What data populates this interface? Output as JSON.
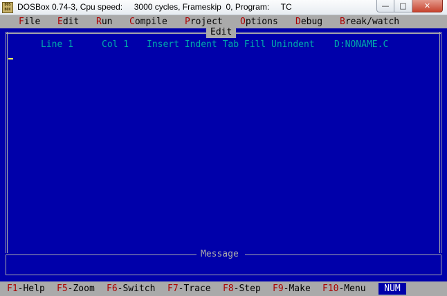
{
  "window": {
    "title": "DOSBox 0.74-3, Cpu speed:     3000 cycles, Frameskip  0, Program:     TC",
    "icon_label": "DOS BOX",
    "minimize_glyph": "—",
    "maximize_glyph": "□",
    "close_glyph": "✕"
  },
  "menu": {
    "items": [
      {
        "hot": "F",
        "rest": "ile"
      },
      {
        "hot": "E",
        "rest": "dit"
      },
      {
        "hot": "R",
        "rest": "un"
      },
      {
        "hot": "C",
        "rest": "ompile"
      },
      {
        "hot": "P",
        "rest": "roject"
      },
      {
        "hot": "O",
        "rest": "ptions"
      },
      {
        "hot": "D",
        "rest": "ebug"
      },
      {
        "hot": "B",
        "rest": "reak/watch"
      }
    ]
  },
  "editor": {
    "title": "Edit",
    "status": {
      "line": "Line 1",
      "col": "Col 1",
      "modes": "Insert Indent Tab Fill Unindent",
      "file": "D:NONAME.C"
    }
  },
  "message": {
    "title": "Message"
  },
  "fkeys": {
    "items": [
      {
        "key": "F1",
        "label": "-Help"
      },
      {
        "key": "F5",
        "label": "-Zoom"
      },
      {
        "key": "F6",
        "label": "-Switch"
      },
      {
        "key": "F7",
        "label": "-Trace"
      },
      {
        "key": "F8",
        "label": "-Step"
      },
      {
        "key": "F9",
        "label": "-Make"
      },
      {
        "key": "F10",
        "label": "-Menu"
      }
    ],
    "indicator": "NUM"
  },
  "colors": {
    "screen_bg": "#0000aa",
    "bar_bg": "#aaaaaa",
    "hotkey": "#aa0000",
    "status_text": "#00aaaa",
    "cursor": "#ffff55"
  }
}
